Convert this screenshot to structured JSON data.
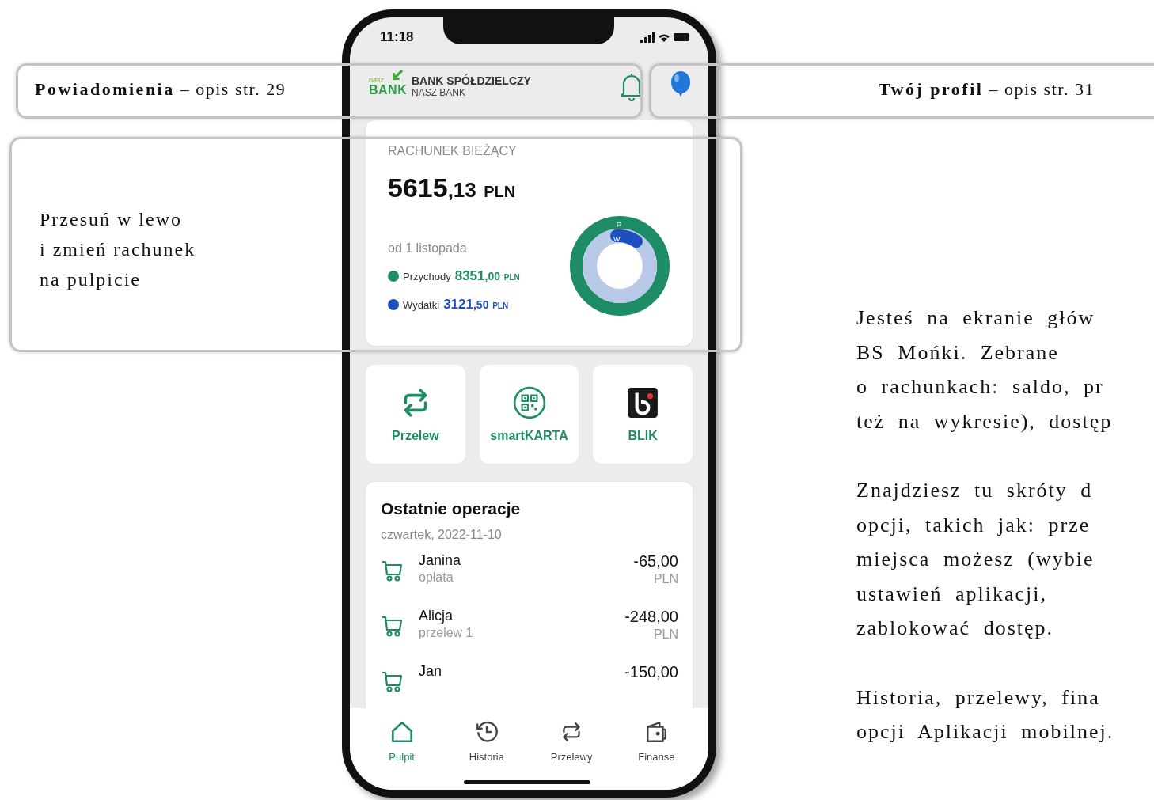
{
  "status_bar": {
    "time": "11:18"
  },
  "header": {
    "logo_small": "nasz",
    "logo_big": "BANK",
    "bank_name": "BANK SPÓŁDZIELCZY",
    "bank_branch": "NASZ BANK"
  },
  "account": {
    "title": "RACHUNEK BIEŻĄCY",
    "balance_int": "5615",
    "balance_dec": ",13",
    "currency": "PLN",
    "period": "od 1 listopada",
    "donut_labels": [
      "P",
      "W"
    ],
    "legend": [
      {
        "label": "Przychody",
        "amount_int": "8351",
        "amount_dec": ",00",
        "currency": "PLN",
        "color": "#1e8c64"
      },
      {
        "label": "Wydatki",
        "amount_int": "3121",
        "amount_dec": ",50",
        "currency": "PLN",
        "color": "#1f4fbf"
      }
    ]
  },
  "shortcuts": [
    {
      "kind": "transfer",
      "label": "Przelew"
    },
    {
      "kind": "qr",
      "label": "smartKARTA"
    },
    {
      "kind": "blik",
      "label": "BLIK"
    }
  ],
  "operations": {
    "title": "Ostatnie operacje",
    "date": "czwartek, 2022-11-10",
    "items": [
      {
        "name": "Janina",
        "desc": "opłata",
        "amount": "-65,00",
        "currency": "PLN"
      },
      {
        "name": "Alicja",
        "desc": "przelew 1",
        "amount": "-248,00",
        "currency": "PLN"
      },
      {
        "name": "Jan",
        "amount": "-150,00"
      }
    ]
  },
  "nav": [
    {
      "kind": "home",
      "label": "Pulpit",
      "selected": true
    },
    {
      "kind": "history",
      "label": "Historia",
      "selected": false
    },
    {
      "kind": "transfer",
      "label": "Przelewy",
      "selected": false
    },
    {
      "kind": "wallet",
      "label": "Finanse",
      "selected": false
    }
  ],
  "annotations": {
    "notifications": {
      "title": "Powiadomienia",
      "ref": "– opis str. 29"
    },
    "profile": {
      "title": "Twój profil",
      "ref": "– opis str. 31"
    },
    "swipe": [
      "Przesuń w lewo",
      "i zmień rachunek",
      "na pulpicie"
    ]
  },
  "description": [
    [
      "Jesteś na ekranie głów",
      "BS Mońki. Zebrane",
      "o rachunkach: saldo, pr",
      "też na wykresie), dostęp"
    ],
    [
      "Znajdziesz tu skróty d",
      "opcji, takich jak: prze",
      "miejsca możesz (wybie",
      "ustawień aplikacji,",
      "zablokować dostęp."
    ],
    [
      "Historia, przelewy, fina",
      "opcji Aplikacji mobilnej."
    ]
  ]
}
